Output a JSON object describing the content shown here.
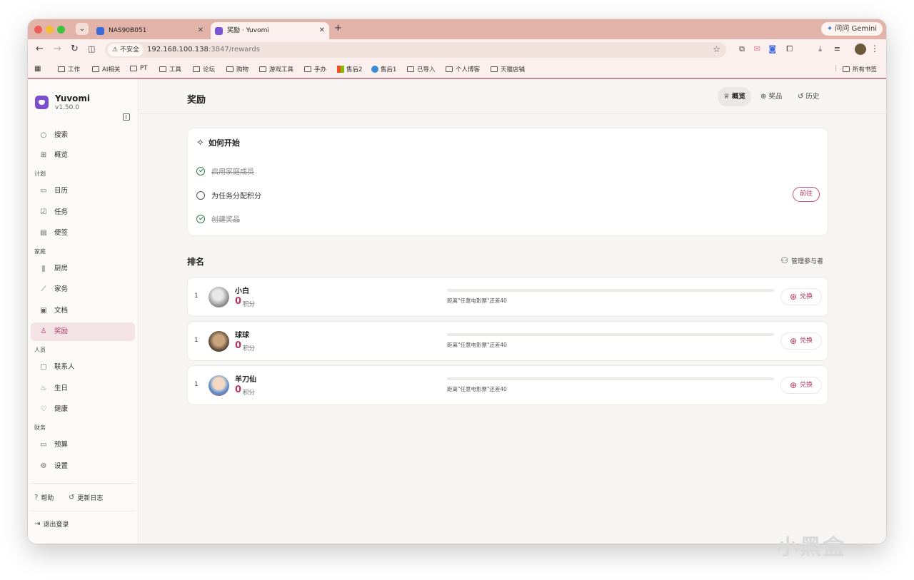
{
  "browser": {
    "tabs": [
      {
        "title": "NAS90B051"
      },
      {
        "title": "奖励 · Yuvomi"
      }
    ],
    "new_tab": "+",
    "gemini_label": "问问 Gemini",
    "security_label": "不安全",
    "url_host": "192.168.100.138",
    "url_path": ":3847/rewards",
    "bookmarks": [
      "工作",
      "AI相关",
      "PT",
      "工具",
      "论坛",
      "购物",
      "游戏工具",
      "手办",
      "售后2",
      "售后1",
      "已导入",
      "个人博客",
      "天猫店铺"
    ],
    "all_bookmarks": "所有书签"
  },
  "sidebar": {
    "app_name": "Yuvomi",
    "version": "v1.50.0",
    "top_items": [
      {
        "label": "搜索",
        "icon": "search-icon"
      },
      {
        "label": "概览",
        "icon": "dashboard-icon"
      }
    ],
    "sections": [
      {
        "label": "计划",
        "items": [
          {
            "label": "日历",
            "icon": "calendar-icon"
          },
          {
            "label": "任务",
            "icon": "task-icon"
          },
          {
            "label": "便签",
            "icon": "note-icon"
          }
        ]
      },
      {
        "label": "家庭",
        "items": [
          {
            "label": "厨房",
            "icon": "utensils-icon"
          },
          {
            "label": "家务",
            "icon": "broom-icon"
          },
          {
            "label": "文档",
            "icon": "folder-icon"
          },
          {
            "label": "奖励",
            "icon": "award-icon",
            "active": true
          }
        ]
      },
      {
        "label": "人员",
        "items": [
          {
            "label": "联系人",
            "icon": "contact-icon"
          },
          {
            "label": "生日",
            "icon": "cake-icon"
          },
          {
            "label": "健康",
            "icon": "heart-pulse-icon"
          }
        ]
      },
      {
        "label": "财务",
        "items": [
          {
            "label": "预算",
            "icon": "wallet-icon"
          },
          {
            "label": "设置",
            "icon": "gear-icon"
          }
        ]
      }
    ],
    "footer": {
      "help": "帮助",
      "changelog": "更新日志",
      "logout": "退出登录"
    }
  },
  "header": {
    "title": "奖励",
    "tabs": [
      {
        "label": "概览",
        "active": true
      },
      {
        "label": "奖品",
        "active": false
      },
      {
        "label": "历史",
        "active": false
      }
    ]
  },
  "getting_started": {
    "title": "如何开始",
    "steps": [
      {
        "label": "启用家庭成员",
        "done": true
      },
      {
        "label": "为任务分配积分",
        "done": false
      },
      {
        "label": "创建奖品",
        "done": true
      }
    ],
    "go_button": "前往"
  },
  "ranking": {
    "title": "排名",
    "manage_label": "管理参与者",
    "unit": "积分",
    "redeem_label": "兑换",
    "rows": [
      {
        "rank": "1",
        "name": "小白",
        "points": "0",
        "hint": "距离\"任意电影票\"还差40",
        "progress": 0
      },
      {
        "rank": "1",
        "name": "球球",
        "points": "0",
        "hint": "距离\"任意电影票\"还差40",
        "progress": 0
      },
      {
        "rank": "1",
        "name": "羊刀仙",
        "points": "0",
        "hint": "距离\"任意电影票\"还差40",
        "progress": 0
      }
    ]
  },
  "watermark": "小黑盒"
}
